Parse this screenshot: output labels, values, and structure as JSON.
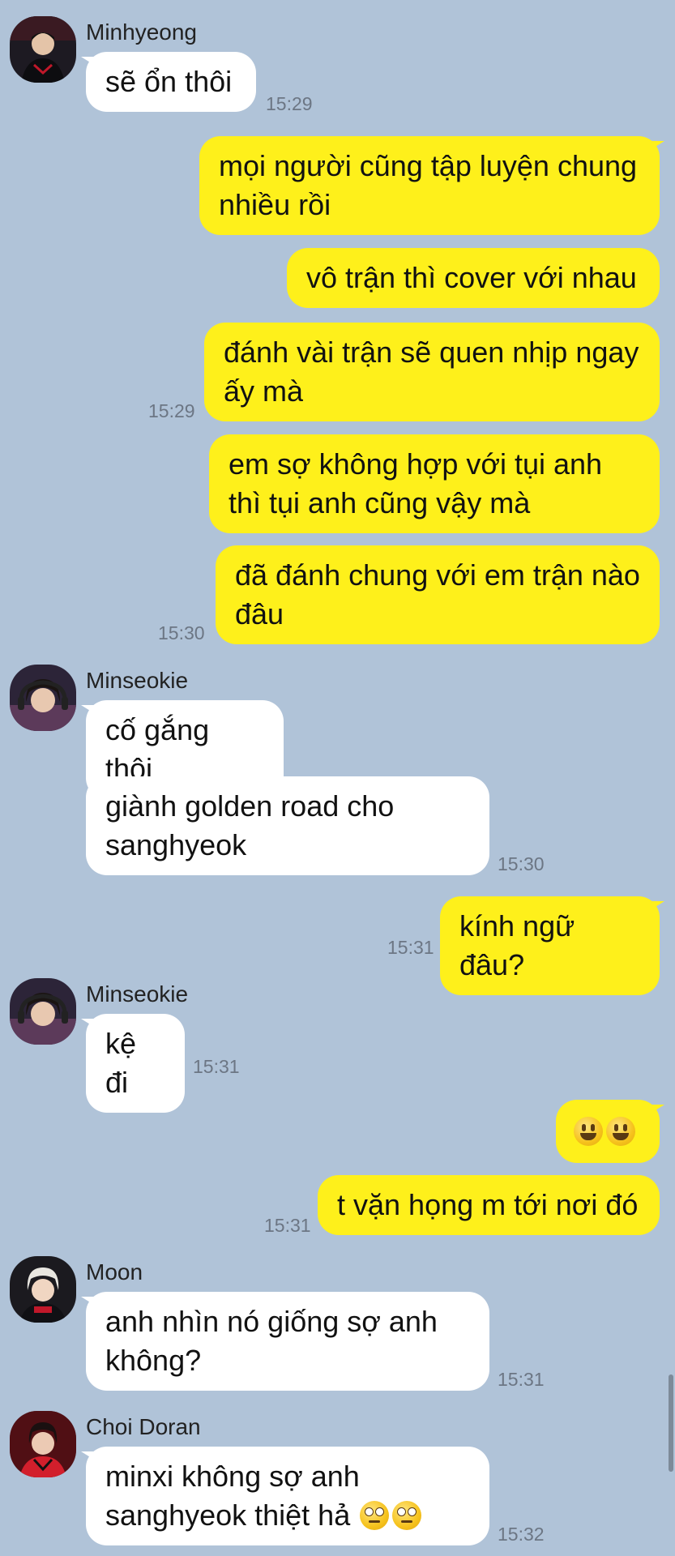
{
  "messages": {
    "m1_sender": "Minhyeong",
    "m1_text": "sẽ ổn thôi",
    "m1_time": "15:29",
    "o1": "mọi người cũng tập luyện chung nhiều rồi",
    "o2": "vô trận thì cover với nhau",
    "o3": "đánh vài trận sẽ quen nhịp ngay ấy mà",
    "o3_time": "15:29",
    "o4": "em sợ không hợp với tụi anh thì tụi anh cũng vậy mà",
    "o5": "đã đánh chung với em trận nào đâu",
    "o5_time": "15:30",
    "m2_sender": "Minseokie",
    "m2_text": "cố gắng thôi",
    "m3_text": "giành golden road cho sanghyeok",
    "m3_time": "15:30",
    "o6": "kính ngữ đâu?",
    "o6_time": "15:31",
    "m4_sender": "Minseokie",
    "m4_text": "kệ đi",
    "m4_time": "15:31",
    "o7_emoji": "grinning-face-emoji x2",
    "o8": "t vặn họng m tới nơi đó",
    "o8_time": "15:31",
    "m5_sender": "Moon",
    "m5_text": "anh nhìn nó giống sợ anh không?",
    "m5_time": "15:31",
    "m6_sender": "Choi Doran",
    "m6_text": "minxi không sợ anh sanghyeok thiệt hả",
    "m6_emoji": "face-with-rolling-eyes-emoji x2",
    "m6_time": "15:32"
  },
  "colors": {
    "background": "#b0c3d8",
    "outgoing_bubble": "#fef01b",
    "incoming_bubble": "#ffffff",
    "time_text": "#6c7684"
  }
}
